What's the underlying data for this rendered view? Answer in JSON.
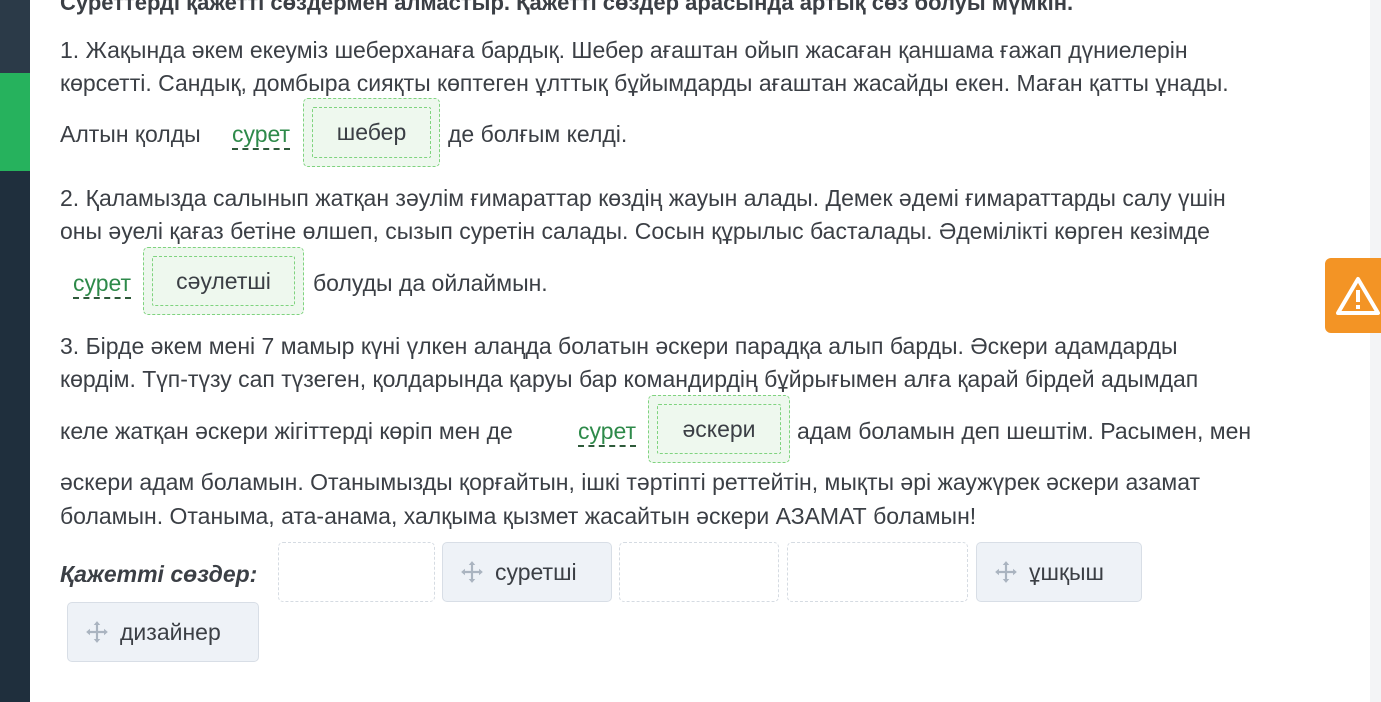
{
  "heading": "Суреттерді қажетті сөздермен алмастыр. Қажетті сөздер арасында артық сөз болуы мүмкін.",
  "p1": {
    "line1": "1. Жақында әкем екеуміз шеберханаға бардық. Шебер ағаштан ойып жасаған қаншама ғажап дүниелерін",
    "line2": "көрсетті. Сандық, домбыра сияқты көптеген ұлттық бұйымдарды ағаштан жасайды екен. Маған қатты ұнады.",
    "before": "Алтын қолды",
    "word": "сурет",
    "slot": "шебер",
    "after": "де болғым келді."
  },
  "p2": {
    "line1": "2. Қаламызда салынып жатқан зәулім ғимараттар көздің жауын алады. Демек әдемі ғимараттарды салу үшін",
    "line2": "оны әуелі қағаз бетіне өлшеп, сызып суретін салады. Сосын құрылыс басталады. Әдемілікті көрген кезімде",
    "word": "сурет",
    "slot": "сәулетші",
    "after": "болуды да ойлаймын."
  },
  "p3": {
    "line1": "3. Бірде әкем мені 7 мамыр күні үлкен алаңда болатын әскери парадқа алып барды. Әскери адамдарды",
    "line2": "көрдім. Түп-түзу сап түзеген, қолдарында қаруы бар командирдің бұйрығымен алға қарай бірдей адымдап",
    "before": "келе жатқан әскери жігіттерді көріп мен де",
    "word": "сурет",
    "slot": "әскери",
    "after": "адам боламын деп шештім. Расымен, мен",
    "line4": "әскери адам боламын. Отанымызды қорғайтын, ішкі тәртіпті реттейтін, мықты әрі жаужүрек әскери азамат",
    "line5": "боламын. Отаныма, ата-анама, халқыма қызмет жасайтын әскери АЗАМАТ боламын!"
  },
  "bank": {
    "label": "Қажетті сөздер:",
    "chips": [
      "суретші",
      "ұшқыш",
      "дизайнер"
    ]
  },
  "icons": {
    "drag": "move-arrows-icon",
    "warning": "warning-icon"
  },
  "colors": {
    "accent": "#26b25d",
    "warning": "#f39425",
    "word": "#2e8a4a"
  }
}
